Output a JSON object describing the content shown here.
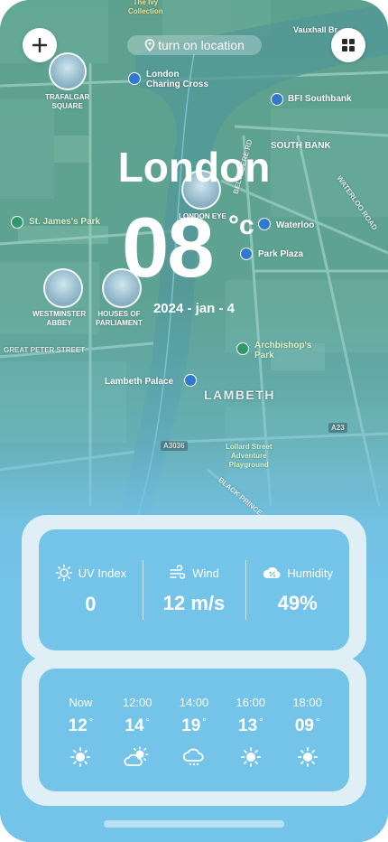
{
  "header": {
    "location_label": "turn on location"
  },
  "hero": {
    "city": "London",
    "temperature": "08",
    "unit": "°c",
    "date": "2024 - jan - 4"
  },
  "stats": [
    {
      "label": "UV Index",
      "value": "0",
      "icon": "sun-icon"
    },
    {
      "label": "Wind",
      "value": "12 m/s",
      "icon": "wind-icon"
    },
    {
      "label": "Humidity",
      "value": "49%",
      "icon": "humidity-icon"
    }
  ],
  "hourly": [
    {
      "time": "Now",
      "temp": "12",
      "icon": "sun-icon"
    },
    {
      "time": "12:00",
      "temp": "14",
      "icon": "partly-cloudy-icon"
    },
    {
      "time": "14:00",
      "temp": "19",
      "icon": "rain-cloud-icon"
    },
    {
      "time": "16:00",
      "temp": "13",
      "icon": "sun-icon"
    },
    {
      "time": "18:00",
      "temp": "09",
      "icon": "sun-icon"
    }
  ],
  "degree_symbol": "°",
  "map": {
    "labels": {
      "ivy": "The Ivy\nCollection",
      "vauxhall": "Vauxhall Br",
      "trafalgar": "TRAFALGAR\nSQUARE",
      "charing": "London\nCharing Cross",
      "bfi": "BFI Southbank",
      "southbank": "SOUTH BANK",
      "eye": "LONDON EYE",
      "stjames": "St. James's Park",
      "waterloo": "Waterloo",
      "parkplaza": "Park Plaza",
      "westminster": "WESTMINSTER\nABBEY",
      "parliament": "HOUSES OF\nPARLIAMENT",
      "greatpeter": "GREAT PETER STREET",
      "archbishop": "Archbishop's\nPark",
      "lambethpalace": "Lambeth Palace",
      "lambeth": "LAMBETH",
      "a3036": "A3036",
      "lollard": "Lollard Street\nAdventure\nPlayground",
      "blackprince": "BLACK PRINCE",
      "a23": "A23",
      "belvedere": "BELVEDERE RD",
      "waterloord": "WATERLOO ROAD"
    }
  }
}
